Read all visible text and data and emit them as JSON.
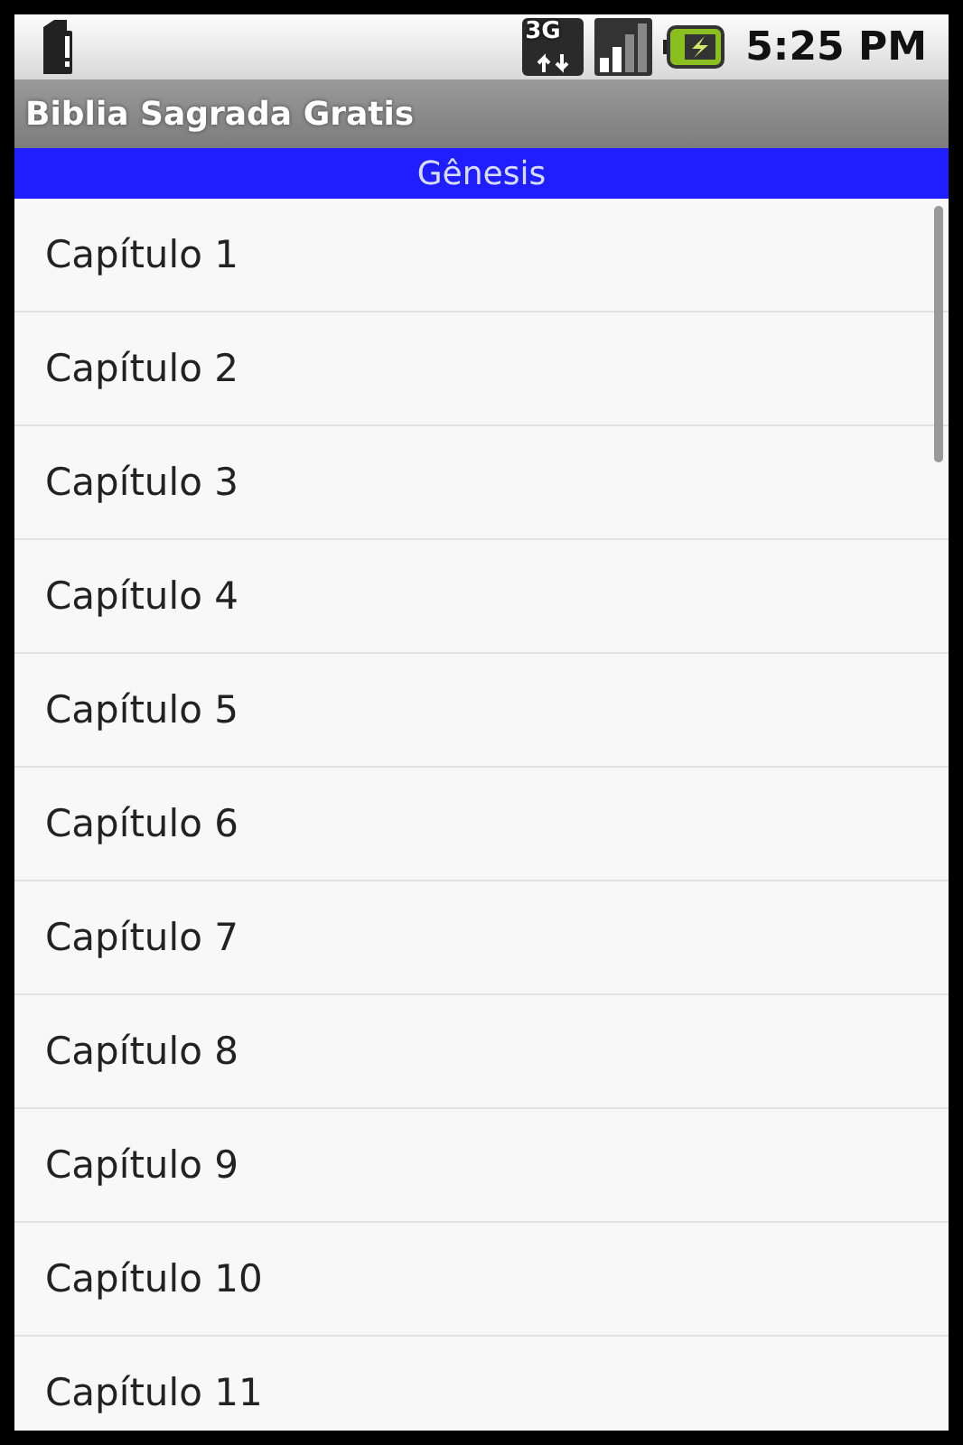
{
  "status_bar": {
    "network_label": "3G",
    "time": "5:25 PM"
  },
  "window": {
    "title": "Biblia Sagrada Gratis"
  },
  "book_header": {
    "title": "Gênesis"
  },
  "chapters": [
    {
      "label": "Capítulo 1"
    },
    {
      "label": "Capítulo 2"
    },
    {
      "label": "Capítulo 3"
    },
    {
      "label": "Capítulo 4"
    },
    {
      "label": "Capítulo 5"
    },
    {
      "label": "Capítulo 6"
    },
    {
      "label": "Capítulo 7"
    },
    {
      "label": "Capítulo 8"
    },
    {
      "label": "Capítulo 9"
    },
    {
      "label": "Capítulo 10"
    },
    {
      "label": "Capítulo 11"
    }
  ]
}
